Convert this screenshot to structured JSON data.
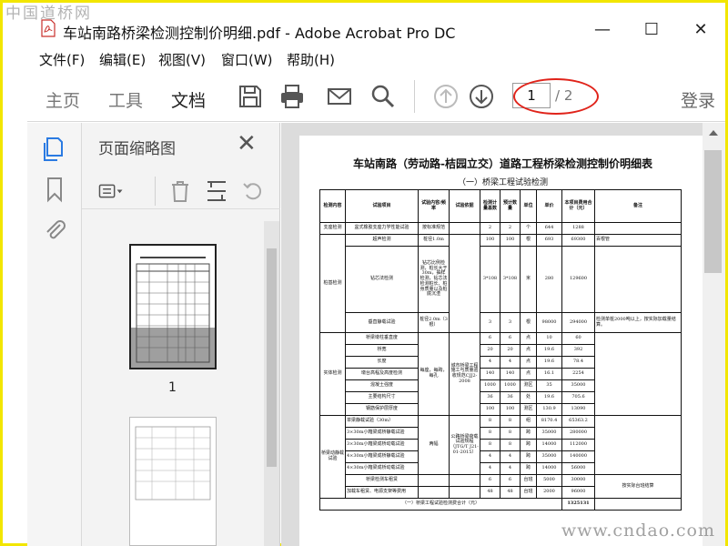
{
  "watermarks": {
    "top": "中国道桥网",
    "bottom": "www.cndao.com"
  },
  "window": {
    "title": "车站南路桥梁检测控制价明细.pdf - Adobe Acrobat Pro DC",
    "minimize": "—",
    "maximize": "☐",
    "close": "✕"
  },
  "menu": [
    "文件(F)",
    "编辑(E)",
    "视图(V)",
    "窗口(W)",
    "帮助(H)"
  ],
  "toolbar": {
    "tabs": [
      "主页",
      "工具",
      "文档"
    ],
    "active_tab": "文档",
    "current_page": "1",
    "total_pages": "/ 2",
    "login": "登录"
  },
  "sidebar": {
    "panel_title": "页面缩略图",
    "thumbnails": [
      "1"
    ]
  },
  "document": {
    "title": "车站南路（劳动路-桔园立交）道路工程桥梁检测控制价明细表",
    "subtitle": "（一）桥梁工程试验检测",
    "headers": [
      "检测内容",
      "试验项目",
      "试验内容/频率",
      "试验依据",
      "检测计量基数",
      "预计数量",
      "单位",
      "单价",
      "本项目费用合计（元）",
      "备注"
    ],
    "rows": [
      {
        "group": "支座检测",
        "item": "盆式橡胶支座力学性能试验",
        "content": "按标准规范",
        "basis": "",
        "base": "2",
        "qty": "2",
        "unit": "个",
        "price": "644",
        "total": "1288",
        "remark": ""
      },
      {
        "group": "桩基检测",
        "item": "超声检测",
        "content": "桩径1.0m",
        "basis": "",
        "base": "100",
        "qty": "100",
        "unit": "根",
        "price": "693",
        "total": "69300",
        "remark": "百根管"
      },
      {
        "group": "",
        "item": "钻芯法检测",
        "content": "钻芯比例检测，桩长大于30m，抽样检测，钻芯法检测桩长、桩身质量以及桩底沉渣",
        "basis": "",
        "base": "3*108",
        "qty": "3*108",
        "unit": "米",
        "price": "280",
        "total": "129600",
        "remark": ""
      },
      {
        "group": "",
        "item": "垂直静载试验",
        "content": "桩径2.0m（3根）",
        "basis": "",
        "base": "3",
        "qty": "3",
        "unit": "根",
        "price": "98000",
        "total": "294000",
        "remark": "检测单桩2000吨以上，按实际加载量结算。"
      },
      {
        "group": "实体检测",
        "item": "桥梁墩柱垂直度",
        "content": "每座，每跨，每孔",
        "basis": "城市桥梁工程施工与质量验收规范CJJ2-2008",
        "base": "6",
        "qty": "6",
        "unit": "点",
        "price": "10",
        "total": "60",
        "remark": ""
      },
      {
        "group": "",
        "item": "桥宽",
        "content": "",
        "basis": "",
        "base": "20",
        "qty": "20",
        "unit": "点",
        "price": "19.6",
        "total": "392",
        "remark": ""
      },
      {
        "group": "",
        "item": "长度",
        "content": "",
        "basis": "",
        "base": "4",
        "qty": "4",
        "unit": "点",
        "price": "19.6",
        "total": "78.4",
        "remark": ""
      },
      {
        "group": "",
        "item": "墩台高程及高度检测",
        "content": "",
        "basis": "",
        "base": "140",
        "qty": "140",
        "unit": "点",
        "price": "16.1",
        "total": "2254",
        "remark": ""
      },
      {
        "group": "",
        "item": "混凝土强度",
        "content": "",
        "basis": "",
        "base": "1000",
        "qty": "1000",
        "unit": "测区",
        "price": "35",
        "total": "35000",
        "remark": ""
      },
      {
        "group": "",
        "item": "主要结构尺寸",
        "content": "",
        "basis": "",
        "base": "36",
        "qty": "36",
        "unit": "处",
        "price": "19.6",
        "total": "705.6",
        "remark": ""
      },
      {
        "group": "",
        "item": "钢筋保护层厚度",
        "content": "",
        "basis": "",
        "base": "100",
        "qty": "100",
        "unit": "测区",
        "price": "130.9",
        "total": "13090",
        "remark": ""
      },
      {
        "group": "桥梁动静载试验",
        "item": "单梁静载试验（30m）",
        "content": "两幅",
        "basis": "公路桥梁荷载试验规程（JTG/T J21-01-2015）",
        "base": "8",
        "qty": "8",
        "unit": "组",
        "price": "8170.4",
        "total": "65363.2",
        "remark": ""
      },
      {
        "group": "",
        "item": "3×30m小箱梁成桥静载试验",
        "content": "",
        "basis": "",
        "base": "8",
        "qty": "8",
        "unit": "跨",
        "price": "35000",
        "total": "280000",
        "remark": ""
      },
      {
        "group": "",
        "item": "3×30m小箱梁成桥动载试验",
        "content": "",
        "basis": "",
        "base": "8",
        "qty": "8",
        "unit": "跨",
        "price": "14000",
        "total": "112000",
        "remark": ""
      },
      {
        "group": "",
        "item": "4×30m小箱梁成桥静载试验",
        "content": "",
        "basis": "",
        "base": "4",
        "qty": "4",
        "unit": "跨",
        "price": "35000",
        "total": "140000",
        "remark": ""
      },
      {
        "group": "",
        "item": "4×30m小箱梁成桥动载试验",
        "content": "",
        "basis": "",
        "base": "4",
        "qty": "4",
        "unit": "跨",
        "price": "14000",
        "total": "56000",
        "remark": ""
      },
      {
        "group": "",
        "item": "桥梁检测车租赁",
        "content": "",
        "basis": "",
        "base": "6",
        "qty": "6",
        "unit": "台班",
        "price": "5000",
        "total": "30000",
        "remark": "按实际台班结算"
      },
      {
        "group": "",
        "item": "加载车租赁、电源支架等费用",
        "content": "",
        "basis": "",
        "base": "48",
        "qty": "48",
        "unit": "台班",
        "price": "2000",
        "total": "96000",
        "remark": ""
      }
    ],
    "total_label": "（一）桥梁工程试验检测费合计（元）",
    "total_value": "1325131"
  }
}
